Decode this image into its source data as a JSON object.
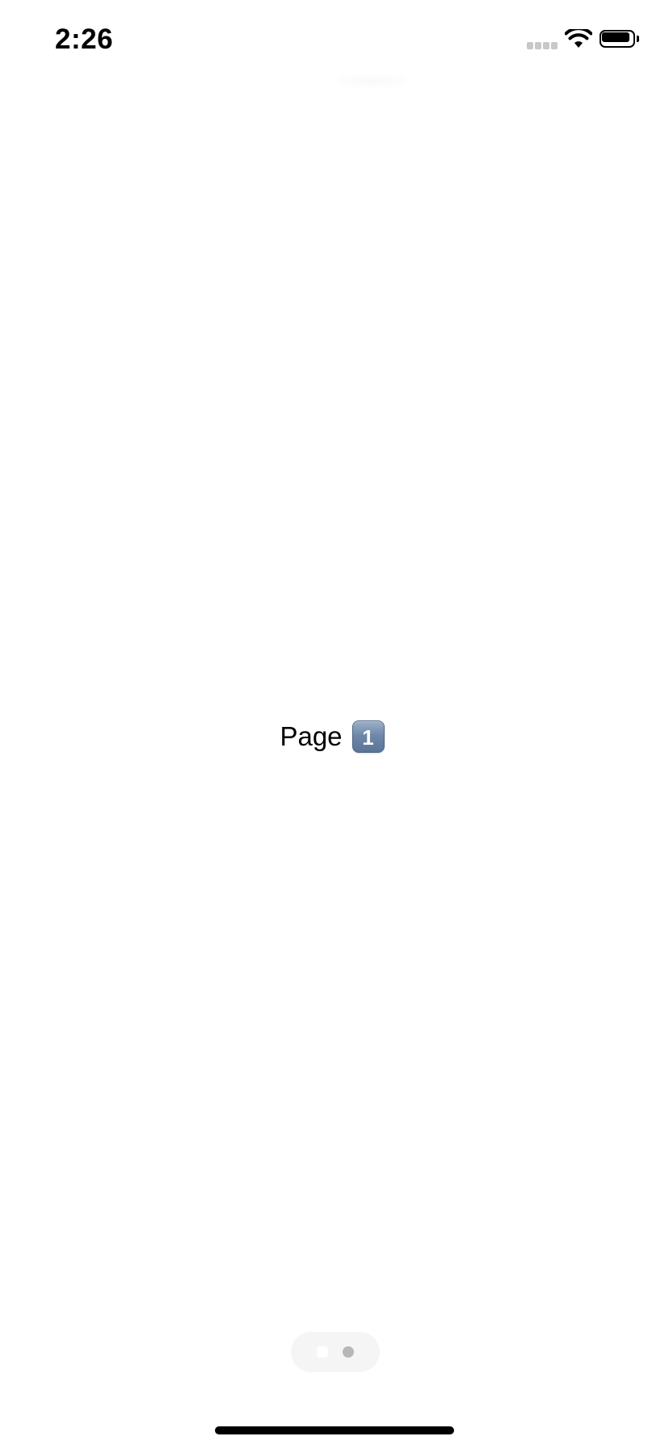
{
  "status_bar": {
    "time": "2:26",
    "icons": [
      "signal-icon",
      "wifi-icon",
      "battery-icon"
    ]
  },
  "content": {
    "page_label": "Page",
    "page_number": "1"
  },
  "page_control": {
    "pages": 2,
    "current_page": 1
  },
  "colors": {
    "background": "#ffffff",
    "text": "#000000",
    "inactive_dot": "#b7b7b7",
    "badge": "#6c87a7"
  }
}
